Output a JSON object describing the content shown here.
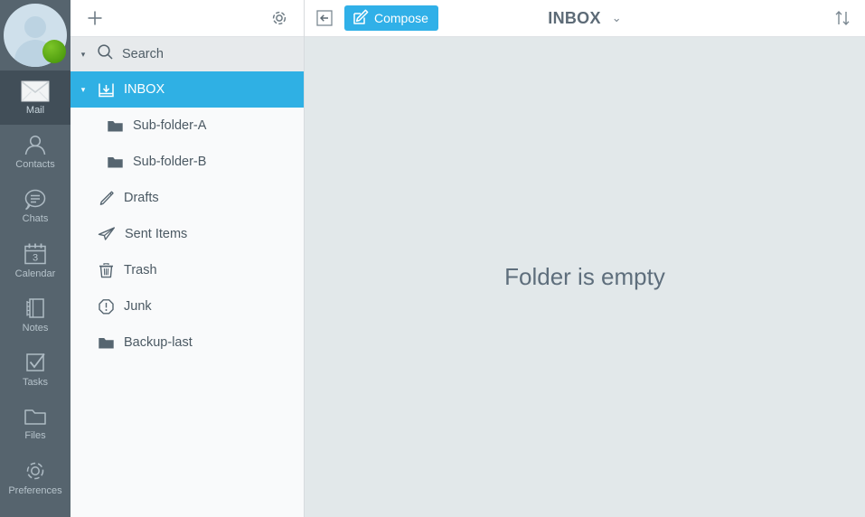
{
  "rail": {
    "avatar": {
      "name": "user-avatar",
      "status": "online",
      "status_color": "#54a812"
    },
    "items": [
      {
        "label": "Mail",
        "icon": "mail-icon",
        "active": true
      },
      {
        "label": "Contacts",
        "icon": "contacts-icon",
        "active": false
      },
      {
        "label": "Chats",
        "icon": "chats-icon",
        "active": false
      },
      {
        "label": "Calendar",
        "icon": "calendar-icon",
        "active": false
      },
      {
        "label": "Notes",
        "icon": "notes-icon",
        "active": false
      },
      {
        "label": "Tasks",
        "icon": "tasks-icon",
        "active": false
      },
      {
        "label": "Files",
        "icon": "files-icon",
        "active": false
      },
      {
        "label": "Preferences",
        "icon": "gear-icon",
        "active": false
      }
    ],
    "calendar_day": "3",
    "background": "#56646e",
    "active_background": "#414e58"
  },
  "folder_panel": {
    "toolbar": {
      "add_label": "+",
      "add_icon": "plus-icon",
      "settings_icon": "gear-icon"
    },
    "search": {
      "label": "Search",
      "icon": "search-icon",
      "caret": "▾"
    },
    "items": [
      {
        "label": "INBOX",
        "icon": "inbox-icon",
        "selected": true,
        "child": false,
        "caret": "▾"
      },
      {
        "label": "Sub-folder-A",
        "icon": "folder-icon",
        "selected": false,
        "child": true,
        "caret": ""
      },
      {
        "label": "Sub-folder-B",
        "icon": "folder-icon",
        "selected": false,
        "child": true,
        "caret": ""
      },
      {
        "label": "Drafts",
        "icon": "pencil-icon",
        "selected": false,
        "child": false,
        "caret": ""
      },
      {
        "label": "Sent Items",
        "icon": "paper-plane-icon",
        "selected": false,
        "child": false,
        "caret": ""
      },
      {
        "label": "Trash",
        "icon": "trash-icon",
        "selected": false,
        "child": false,
        "caret": ""
      },
      {
        "label": "Junk",
        "icon": "junk-icon",
        "selected": false,
        "child": false,
        "caret": ""
      },
      {
        "label": "Backup-last",
        "icon": "folder-icon",
        "selected": false,
        "child": false,
        "caret": ""
      }
    ],
    "selected_color": "#2fb0e4"
  },
  "mail_panel": {
    "collapse_icon": "collapse-left-icon",
    "compose_label": "Compose",
    "compose_icon": "compose-icon",
    "compose_color": "#30b0e8",
    "title": "INBOX",
    "title_dropdown": "⌄",
    "sort_icon": "sort-icon",
    "empty_message": "Folder is empty",
    "background": "#e2e8ea"
  }
}
